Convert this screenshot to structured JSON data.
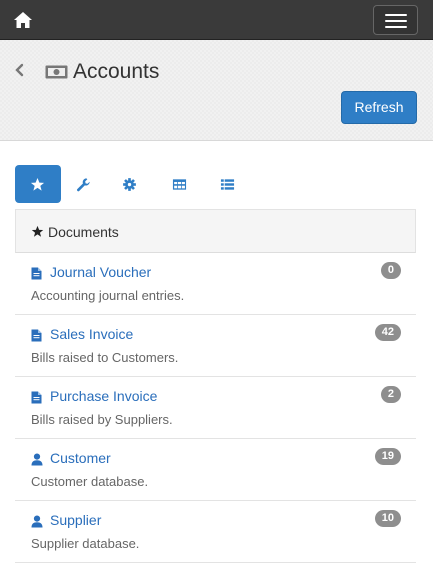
{
  "navbar": {
    "home_icon": "home-icon",
    "toggle_icon": "hamburger-icon"
  },
  "header": {
    "back_icon": "chevron-left-icon",
    "title_icon": "money-icon",
    "title": "Accounts",
    "refresh_label": "Refresh"
  },
  "tabs": [
    {
      "icon": "star-icon",
      "active": true
    },
    {
      "icon": "wrench-icon",
      "active": false
    },
    {
      "icon": "gear-icon",
      "active": false
    },
    {
      "icon": "table-icon",
      "active": false
    },
    {
      "icon": "list-icon",
      "active": false
    }
  ],
  "section": {
    "icon": "star-icon",
    "label": "Documents"
  },
  "items": [
    {
      "icon": "file-icon",
      "title": "Journal Voucher",
      "description": "Accounting journal entries.",
      "count": "0"
    },
    {
      "icon": "file-icon",
      "title": "Sales Invoice",
      "description": "Bills raised to Customers.",
      "count": "42"
    },
    {
      "icon": "file-icon",
      "title": "Purchase Invoice",
      "description": "Bills raised by Suppliers.",
      "count": "2"
    },
    {
      "icon": "user-icon",
      "title": "Customer",
      "description": "Customer database.",
      "count": "19"
    },
    {
      "icon": "user-icon",
      "title": "Supplier",
      "description": "Supplier database.",
      "count": "10"
    }
  ],
  "colors": {
    "navbar": "#3a3a3a",
    "primary": "#2f7ec6",
    "link": "#2a6ebb",
    "badge": "#8e8e8e"
  }
}
